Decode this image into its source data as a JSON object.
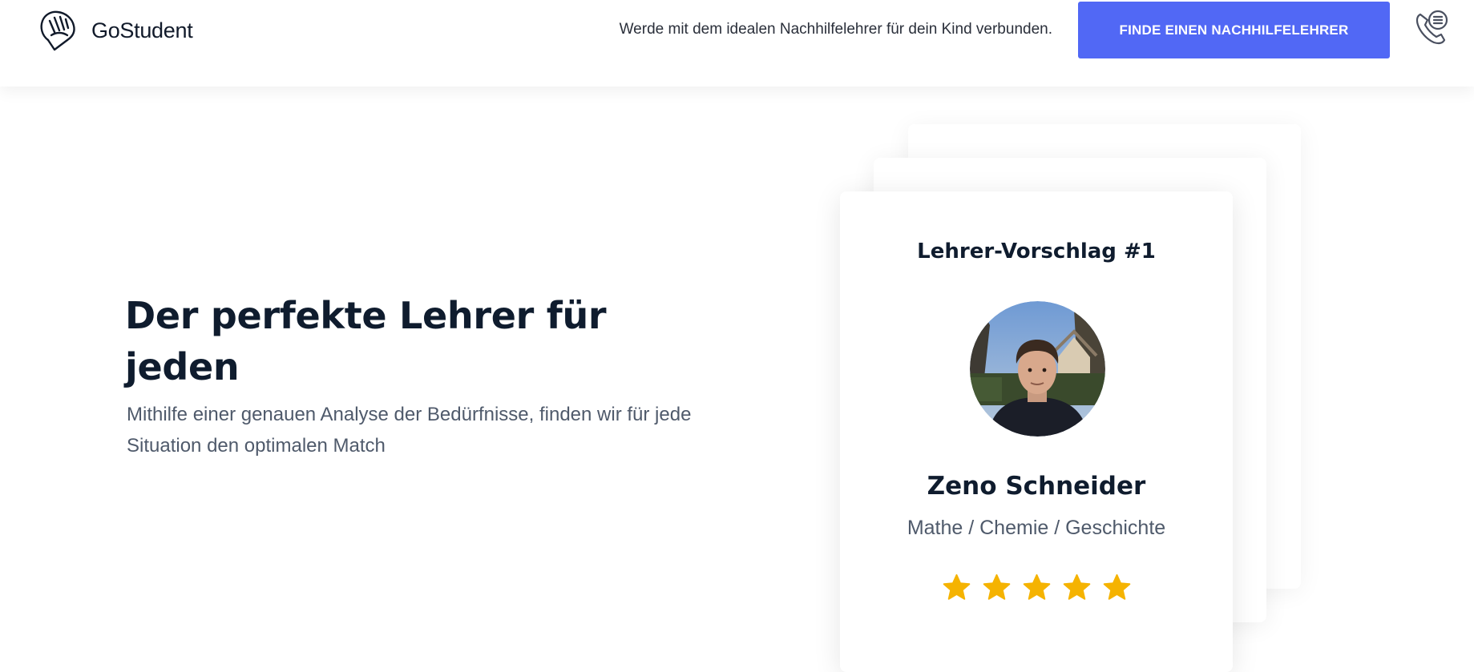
{
  "header": {
    "logo_text": "GoStudent",
    "logo_icon": "gostudent-hand-logo-icon",
    "tagline": "Werde mit dem idealen Nachhilfelehrer für dein Kind verbunden.",
    "cta_label": "FINDE EINEN NACHHILFELEHRER",
    "phone_icon": "phone-callback-icon"
  },
  "hero": {
    "title": "Der perfekte Lehrer für jeden",
    "subtitle": "Mithilfe einer genauen Analyse der Bedürfnisse, finden wir für jede Situation den optimalen Match"
  },
  "teacher_card": {
    "heading": "Lehrer-Vorschlag #1",
    "name": "Zeno Schneider",
    "subjects": "Mathe / Chemie / Geschichte",
    "rating": 5,
    "rating_max": 5,
    "avatar_icon": "teacher-photo"
  },
  "colors": {
    "accent": "#5168f5",
    "star": "#f5b301",
    "text_dark": "#0f1c2e",
    "text_muted": "#4f5a6b"
  }
}
